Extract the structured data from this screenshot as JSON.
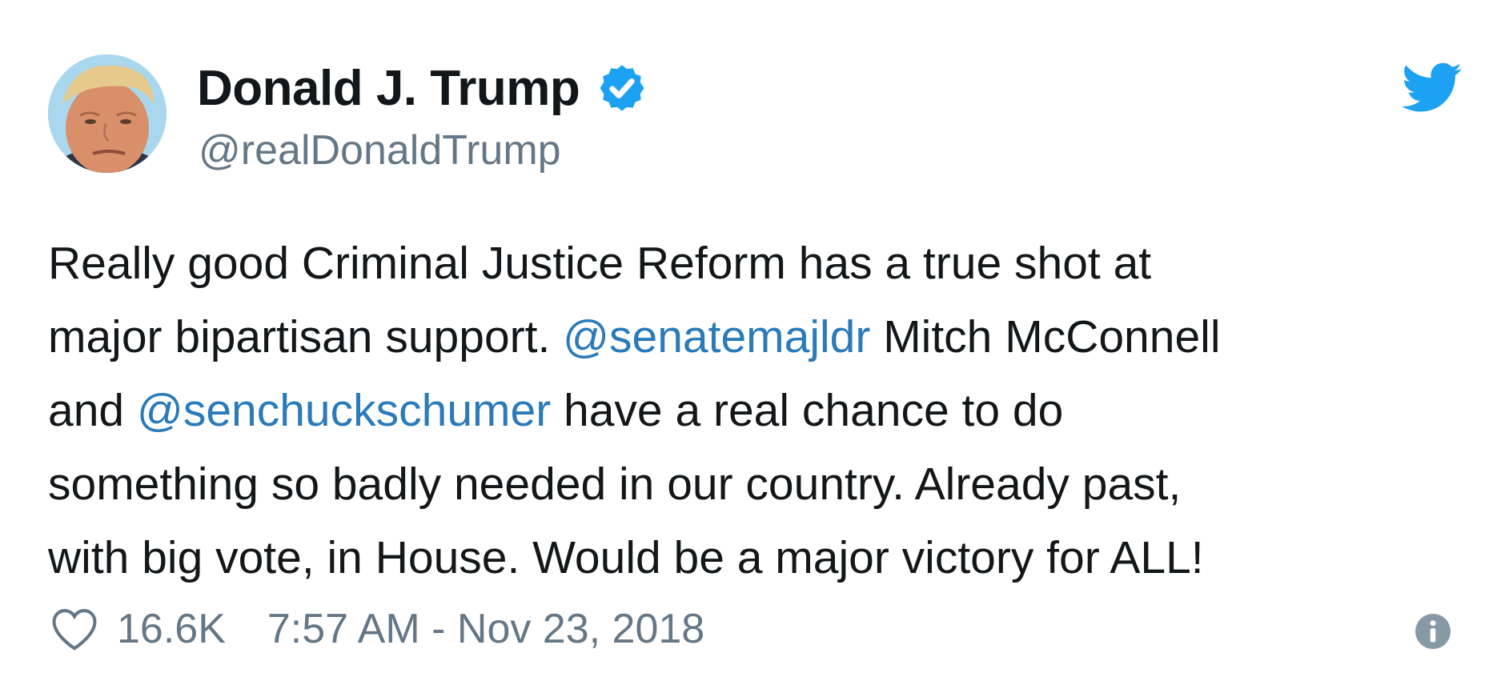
{
  "user": {
    "display_name": "Donald J. Trump",
    "handle": "@realDonaldTrump",
    "verified": true,
    "verified_icon": "verified-badge-icon",
    "avatar_icon": "profile-photo"
  },
  "brand": {
    "logo_icon": "twitter-bird-icon",
    "accent_color": "#1da1f2",
    "mention_color": "#2b7bb9",
    "secondary_text_color": "#657786"
  },
  "tweet": {
    "lines": [
      [
        {
          "text": "Really good Criminal Justice Reform has a true shot at"
        }
      ],
      [
        {
          "text": "major bipartisan support. "
        },
        {
          "text": "@senatemajldr"
        },
        {
          "text": " Mitch McConnell"
        }
      ],
      [
        {
          "text": "and "
        },
        {
          "text": "@senchuckschumer"
        },
        {
          "text": " have a real chance to do"
        }
      ],
      [
        {
          "text": "something so badly needed in our country. Already past,"
        }
      ],
      [
        {
          "text": "with big vote, in House. Would be a major victory for ALL!"
        }
      ]
    ]
  },
  "footer": {
    "like_icon": "heart-icon",
    "likes": "16.6K",
    "timestamp": "7:57 AM - Nov 23, 2018",
    "info_icon": "info-icon"
  }
}
